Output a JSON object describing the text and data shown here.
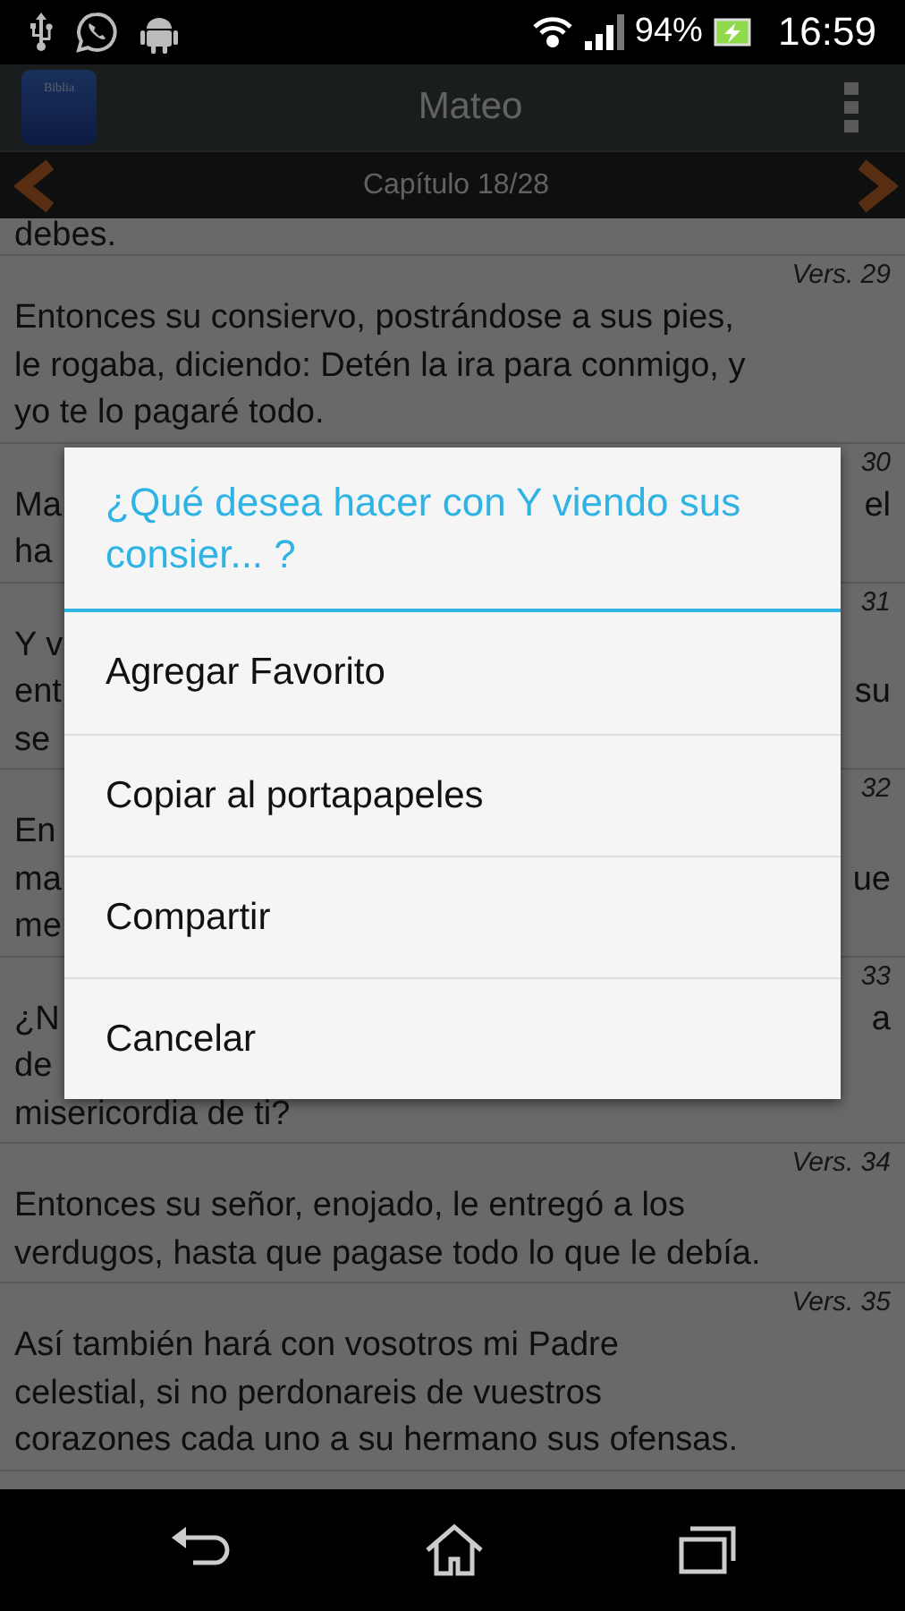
{
  "status_bar": {
    "battery": "94%",
    "time": "16:59"
  },
  "app_bar": {
    "icon_label": "Biblia",
    "title": "Mateo"
  },
  "chapter_bar": {
    "title": "Capítulo 18/28"
  },
  "top_fragment": "debes.",
  "verses": [
    {
      "kind": "full",
      "label": "Vers. 29",
      "lines": [
        {
          "left": "Entonces su consiervo, postrándose a sus pies,"
        },
        {
          "left": "le rogaba, diciendo: Detén la ira para conmigo, y"
        },
        {
          "left": "yo te lo pagaré todo."
        }
      ]
    },
    {
      "kind": "covered",
      "label": "30",
      "lines": [
        {
          "left": "Ma",
          "right": "el"
        },
        {
          "left": "ha"
        }
      ]
    },
    {
      "kind": "covered",
      "label": "31",
      "lines": [
        {
          "left": "Y v"
        },
        {
          "left": "ent",
          "right": "su"
        },
        {
          "left": "se"
        }
      ]
    },
    {
      "kind": "covered",
      "label": "32",
      "lines": [
        {
          "left": "En"
        },
        {
          "left": "ma",
          "right": "ue"
        },
        {
          "left": "me"
        }
      ]
    },
    {
      "kind": "covered",
      "label": "33",
      "lines": [
        {
          "left": "¿N",
          "right": "a"
        },
        {
          "left": "de"
        },
        {
          "left": "misericordia de ti?"
        }
      ]
    },
    {
      "kind": "full",
      "label": "Vers. 34",
      "lines": [
        {
          "left": "Entonces su señor, enojado, le entregó a los"
        },
        {
          "left": "verdugos, hasta que pagase todo lo que le debía."
        }
      ]
    },
    {
      "kind": "full",
      "label": "Vers. 35",
      "lines": [
        {
          "left": "Así también hará con vosotros mi Padre"
        },
        {
          "left": "celestial, si no perdonareis de vuestros"
        },
        {
          "left": "corazones cada uno a su hermano sus ofensas."
        }
      ]
    }
  ],
  "dialog": {
    "title": "¿Qué desea hacer con Y viendo sus consier... ?",
    "items": [
      "Agregar Favorito",
      "Copiar al portapapeles",
      "Compartir",
      "Cancelar"
    ]
  }
}
